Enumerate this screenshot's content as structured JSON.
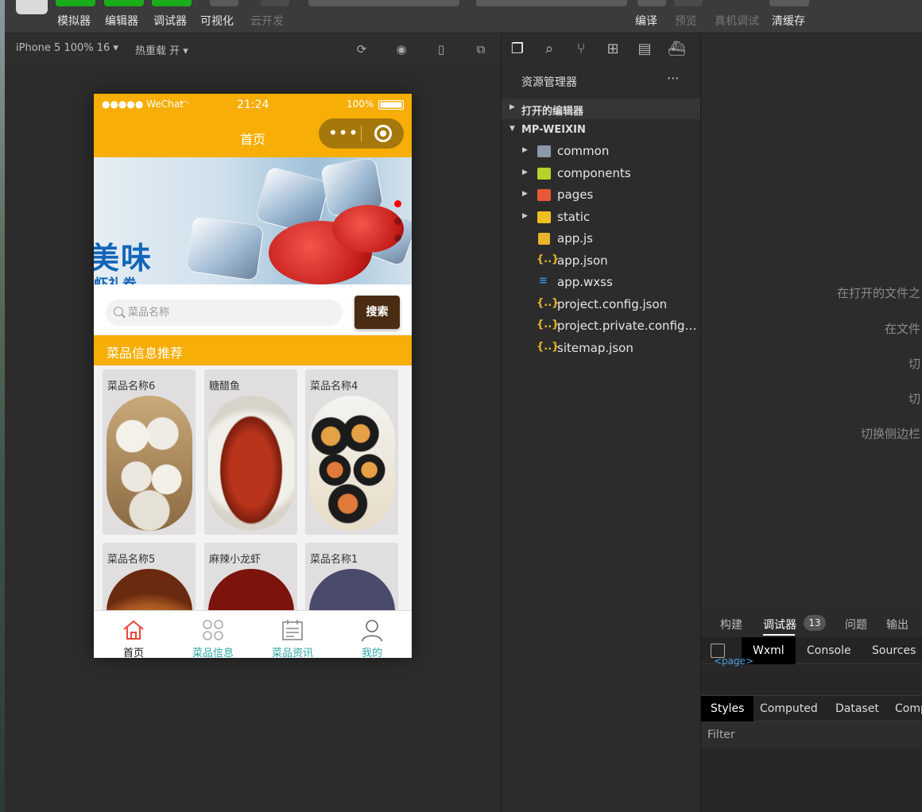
{
  "toolbar": {
    "buttons": [
      {
        "label": "模拟器"
      },
      {
        "label": "编辑器"
      },
      {
        "label": "调试器"
      },
      {
        "label": "可视化"
      },
      {
        "label": "云开发"
      }
    ],
    "right_actions": [
      {
        "label": "编译"
      },
      {
        "label": "预览"
      },
      {
        "label": "真机调试"
      },
      {
        "label": "清缓存"
      }
    ],
    "colors": {
      "active_tool": "#1aad19",
      "disabled_text": "#777777"
    }
  },
  "simulator": {
    "device": "iPhone 5 100% 16 ▾",
    "hot_reload": "热重载 开 ▾",
    "phone": {
      "status": {
        "carrier": "●●●●● WeChat",
        "wifi": "wifi-icon",
        "time": "21:24",
        "battery": "100%"
      },
      "nav_title": "首页",
      "banner": {
        "text": "美味",
        "sub": "虾礼券",
        "dots": 3,
        "active_dot": 0
      },
      "search": {
        "placeholder": "菜品名称",
        "button": "搜索"
      },
      "section_title": "菜品信息推荐",
      "dishes": [
        {
          "name": "菜品名称6",
          "image": "steamed-dumplings"
        },
        {
          "name": "糖醋鱼",
          "image": "sweet-sour-fish"
        },
        {
          "name": "菜品名称4",
          "image": "sushi-rolls"
        },
        {
          "name": "菜品名称5",
          "image": "pizza"
        },
        {
          "name": "麻辣小龙虾",
          "image": "spicy-crayfish"
        },
        {
          "name": "菜品名称1",
          "image": "cake"
        }
      ],
      "tabs": [
        {
          "label": "首页",
          "icon": "home-icon",
          "active": true
        },
        {
          "label": "菜品信息",
          "icon": "grid-icon",
          "active": false
        },
        {
          "label": "菜品资讯",
          "icon": "calendar-icon",
          "active": false
        },
        {
          "label": "我的",
          "icon": "user-icon",
          "active": false
        }
      ],
      "colors": {
        "theme": "#f7ae07",
        "search_button": "#4a2c12",
        "tab_text": "#2aa5a5"
      }
    }
  },
  "explorer": {
    "title": "资源管理器",
    "more": "···",
    "sections": {
      "open_editors": "打开的编辑器",
      "project": "MP-WEIXIN"
    },
    "items": [
      {
        "name": "common",
        "type": "folder"
      },
      {
        "name": "components",
        "type": "folder"
      },
      {
        "name": "pages",
        "type": "folder"
      },
      {
        "name": "static",
        "type": "folder"
      },
      {
        "name": "app.js",
        "type": "js"
      },
      {
        "name": "app.json",
        "type": "json"
      },
      {
        "name": "app.wxss",
        "type": "wxss"
      },
      {
        "name": "project.config.json",
        "type": "json"
      },
      {
        "name": "project.private.config.json",
        "type": "json"
      },
      {
        "name": "sitemap.json",
        "type": "json"
      }
    ]
  },
  "right_panel": {
    "hints": [
      "在打开的文件之",
      "在文件",
      "切",
      "切",
      "切换侧边栏"
    ]
  },
  "devtools": {
    "tabs": [
      "构建",
      "调试器",
      "问题",
      "输出"
    ],
    "badge": "13",
    "subtabs": [
      "Wxml",
      "Console",
      "Sources"
    ],
    "page_tag": "<page>",
    "style_tabs": [
      "Styles",
      "Computed",
      "Dataset",
      "Comp"
    ],
    "filter_placeholder": "Filter"
  }
}
